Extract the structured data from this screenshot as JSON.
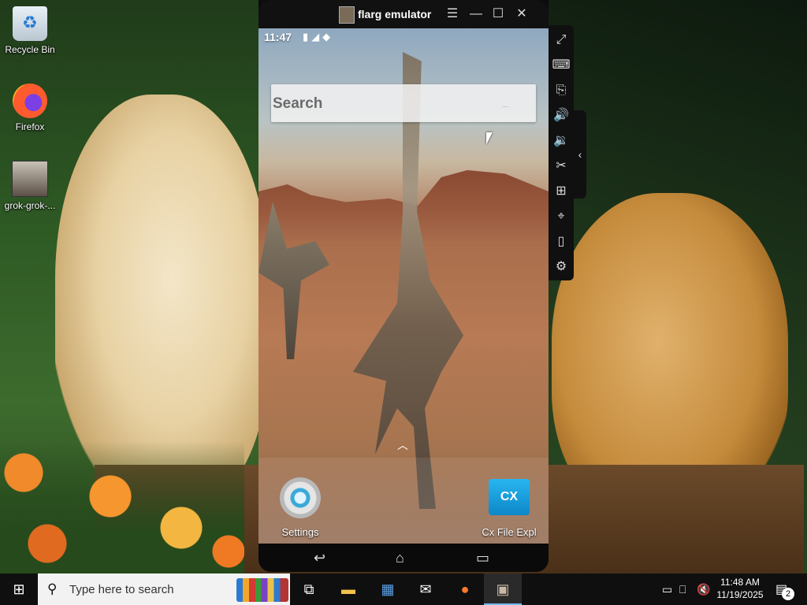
{
  "desktop": {
    "icons": [
      {
        "label": "Recycle Bin",
        "icon": "recycle-bin-icon"
      },
      {
        "label": "Firefox",
        "icon": "firefox-icon"
      },
      {
        "label": "grok-grok-...",
        "icon": "image-file-icon"
      }
    ]
  },
  "emulator": {
    "title": "flarg emulator",
    "title_buttons": {
      "menu": "☰",
      "minimize": "—",
      "maximize": "☐",
      "close": "✕"
    },
    "status_bar": {
      "time": "11:47"
    },
    "search": {
      "placeholder": "Search",
      "dots": "...."
    },
    "apps": [
      {
        "label": "Settings",
        "icon": "settings-gear-icon"
      },
      {
        "label": "Cx File Expl",
        "icon_text": "CX",
        "icon": "cx-file-explorer-icon"
      }
    ],
    "nav": {
      "back": "↩",
      "home": "⌂",
      "recents": "▭"
    },
    "sidebar": [
      {
        "icon": "fullscreen-icon",
        "glyph": "⤢"
      },
      {
        "icon": "keyboard-icon",
        "glyph": "⌨"
      },
      {
        "icon": "apk-install-icon",
        "glyph": "⎘"
      },
      {
        "icon": "volume-up-icon",
        "glyph": "🔊"
      },
      {
        "icon": "volume-down-icon",
        "glyph": "🔉"
      },
      {
        "icon": "scissors-icon",
        "glyph": "✂"
      },
      {
        "icon": "add-window-icon",
        "glyph": "⊞"
      },
      {
        "icon": "location-icon",
        "glyph": "⌖"
      },
      {
        "icon": "shake-icon",
        "glyph": "▯"
      },
      {
        "icon": "settings-icon",
        "glyph": "⚙"
      }
    ],
    "sidebar_toggle": "‹"
  },
  "taskbar": {
    "search_placeholder": "Type here to search",
    "clock_time": "11:48 AM",
    "clock_date": "11/19/2025",
    "notifications_count": "2"
  }
}
